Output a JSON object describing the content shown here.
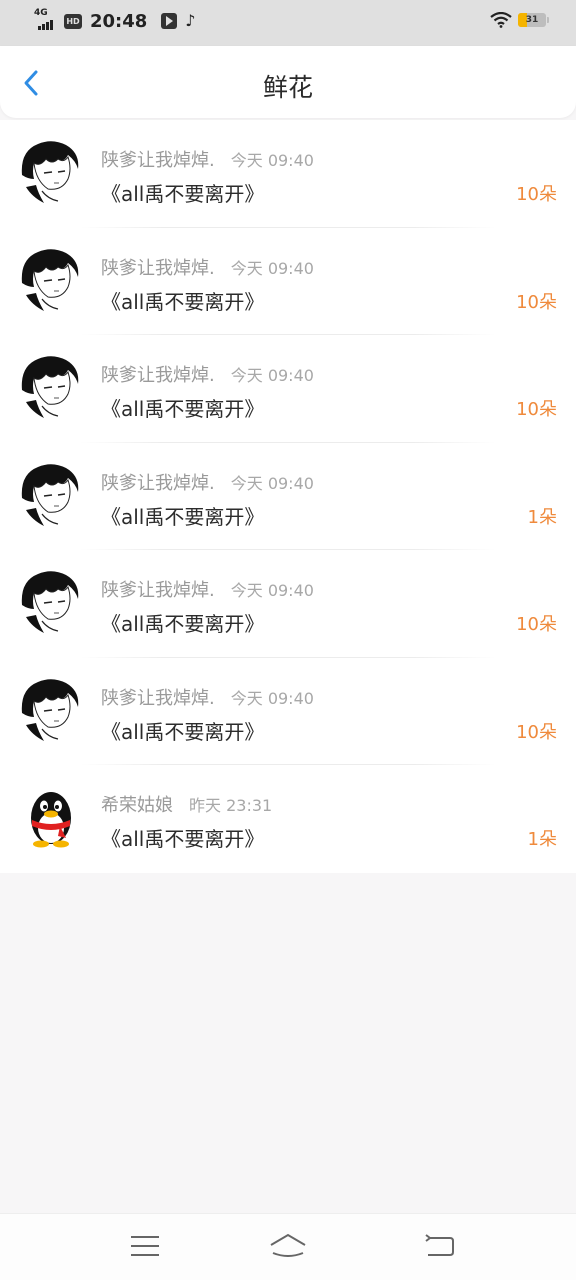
{
  "status_bar": {
    "network": "4G",
    "hd_label": "HD",
    "time": "20:48",
    "battery_level": "31",
    "icons": [
      "signal-icon",
      "hd-icon",
      "video-app-icon",
      "tiktok-icon",
      "wifi-icon",
      "battery-icon"
    ]
  },
  "header": {
    "back_icon": "chevron-left-icon",
    "title": "鲜花"
  },
  "colors": {
    "accent": "#2f8de4",
    "flower_count": "#ef8a3c",
    "meta_text": "#9a9a9a",
    "status_bar_bg": "#e0e0e0",
    "page_bg": "#f7f6f7",
    "battery": "#f5b400"
  },
  "records": [
    {
      "sender": "陕爹让我焯焯.",
      "time": "今天 09:40",
      "book": "《all禹不要离开》",
      "count": "10朵",
      "avatar": "manga-avatar"
    },
    {
      "sender": "陕爹让我焯焯.",
      "time": "今天 09:40",
      "book": "《all禹不要离开》",
      "count": "10朵",
      "avatar": "manga-avatar"
    },
    {
      "sender": "陕爹让我焯焯.",
      "time": "今天 09:40",
      "book": "《all禹不要离开》",
      "count": "10朵",
      "avatar": "manga-avatar"
    },
    {
      "sender": "陕爹让我焯焯.",
      "time": "今天 09:40",
      "book": "《all禹不要离开》",
      "count": "1朵",
      "avatar": "manga-avatar"
    },
    {
      "sender": "陕爹让我焯焯.",
      "time": "今天 09:40",
      "book": "《all禹不要离开》",
      "count": "10朵",
      "avatar": "manga-avatar"
    },
    {
      "sender": "陕爹让我焯焯.",
      "time": "今天 09:40",
      "book": "《all禹不要离开》",
      "count": "10朵",
      "avatar": "manga-avatar"
    },
    {
      "sender": "希荣姑娘",
      "time": "昨天 23:31",
      "book": "《all禹不要离开》",
      "count": "1朵",
      "avatar": "penguin-avatar"
    }
  ],
  "nav_bar": {
    "items": [
      "menu-icon",
      "home-icon",
      "back-icon"
    ]
  }
}
